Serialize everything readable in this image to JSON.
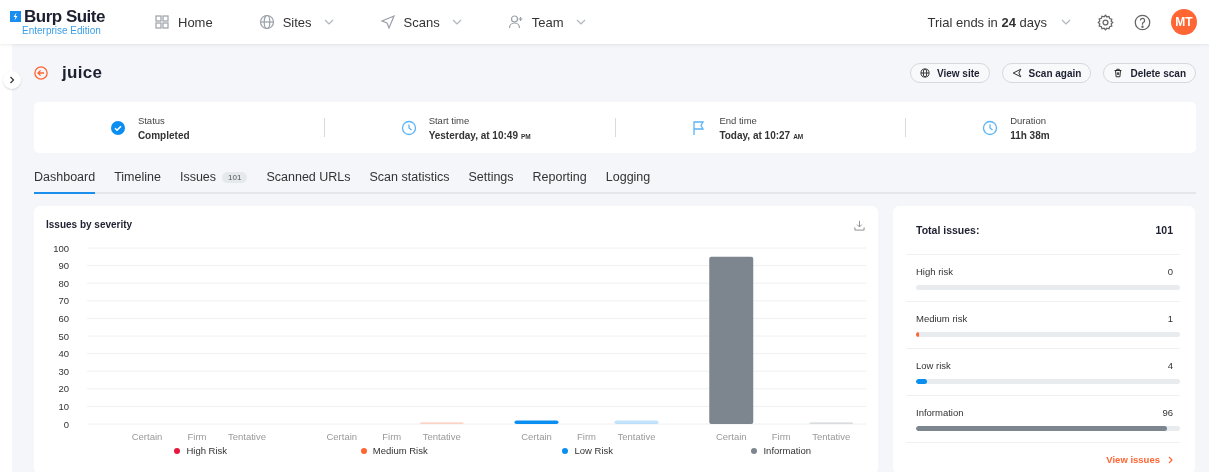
{
  "header": {
    "logo_title": "Burp Suite",
    "logo_subtitle": "Enterprise Edition",
    "nav": [
      {
        "label": "Home",
        "dropdown": false
      },
      {
        "label": "Sites",
        "dropdown": true
      },
      {
        "label": "Scans",
        "dropdown": true
      },
      {
        "label": "Team",
        "dropdown": true
      }
    ],
    "trial": "Trial ends in **24** days",
    "avatar": "MT"
  },
  "scan": {
    "title": "juice",
    "actions": [
      "View site",
      "Scan again",
      "Delete scan"
    ]
  },
  "info": [
    {
      "kind": "status",
      "label": "Status",
      "value": "Completed"
    },
    {
      "kind": "clock",
      "label": "Start time",
      "value": "Yesterday, at 10:49",
      "suffix": "PM"
    },
    {
      "kind": "flag",
      "label": "End time",
      "value": "Today, at 10:27",
      "suffix": "AM"
    },
    {
      "kind": "clock",
      "label": "Duration",
      "value": "11h 38m"
    }
  ],
  "tabs": [
    {
      "label": "Dashboard",
      "selected": true
    },
    {
      "label": "Timeline",
      "selected": false
    },
    {
      "label": "Issues",
      "badge": "101",
      "selected": false
    },
    {
      "label": "Scanned URLs",
      "selected": false
    },
    {
      "label": "Scan statistics",
      "selected": false
    },
    {
      "label": "Settings",
      "selected": false
    },
    {
      "label": "Reporting",
      "selected": false
    },
    {
      "label": "Logging",
      "selected": false
    }
  ],
  "chart": {
    "chart_data": {
      "type": "bar",
      "title": "Issues by severity",
      "categories": [
        "Certain",
        "Firm",
        "Tentative",
        "Certain",
        "Firm",
        "Tentative",
        "Certain",
        "Firm",
        "Tentative",
        "Certain",
        "Firm",
        "Tentative"
      ],
      "ylim": [
        0,
        100
      ],
      "yticks": [
        0,
        10,
        20,
        30,
        40,
        50,
        60,
        70,
        80,
        90,
        100
      ],
      "grid": true,
      "series": [
        {
          "name": "High Risk",
          "color": "#e8173d",
          "values": [
            0,
            0,
            0,
            null,
            null,
            null,
            null,
            null,
            null,
            null,
            null,
            null
          ]
        },
        {
          "name": "Medium Risk",
          "color": "#ff6633",
          "values": [
            null,
            null,
            null,
            0,
            0,
            1,
            null,
            null,
            null,
            null,
            null,
            null
          ]
        },
        {
          "name": "Low Risk",
          "color": "#0a8ef0",
          "values": [
            null,
            null,
            null,
            null,
            null,
            null,
            2,
            0,
            2,
            null,
            null,
            null
          ]
        },
        {
          "name": "Information",
          "color": "#7d868f",
          "values": [
            null,
            null,
            null,
            null,
            null,
            null,
            null,
            null,
            null,
            95,
            0,
            1
          ]
        }
      ]
    }
  },
  "summary": {
    "total_label": "Total issues:",
    "total": "101",
    "rows": [
      {
        "label": "High risk",
        "count": "0"
      },
      {
        "label": "Medium risk",
        "count": "1",
        "level": 0.01,
        "color": "#ff6633"
      },
      {
        "label": "Low risk",
        "count": "4",
        "level": 0.04,
        "color": "#0a8ef0"
      },
      {
        "label": "Information",
        "count": "96",
        "level": 0.95,
        "color": "#7d868f"
      }
    ],
    "link": "View issues"
  }
}
